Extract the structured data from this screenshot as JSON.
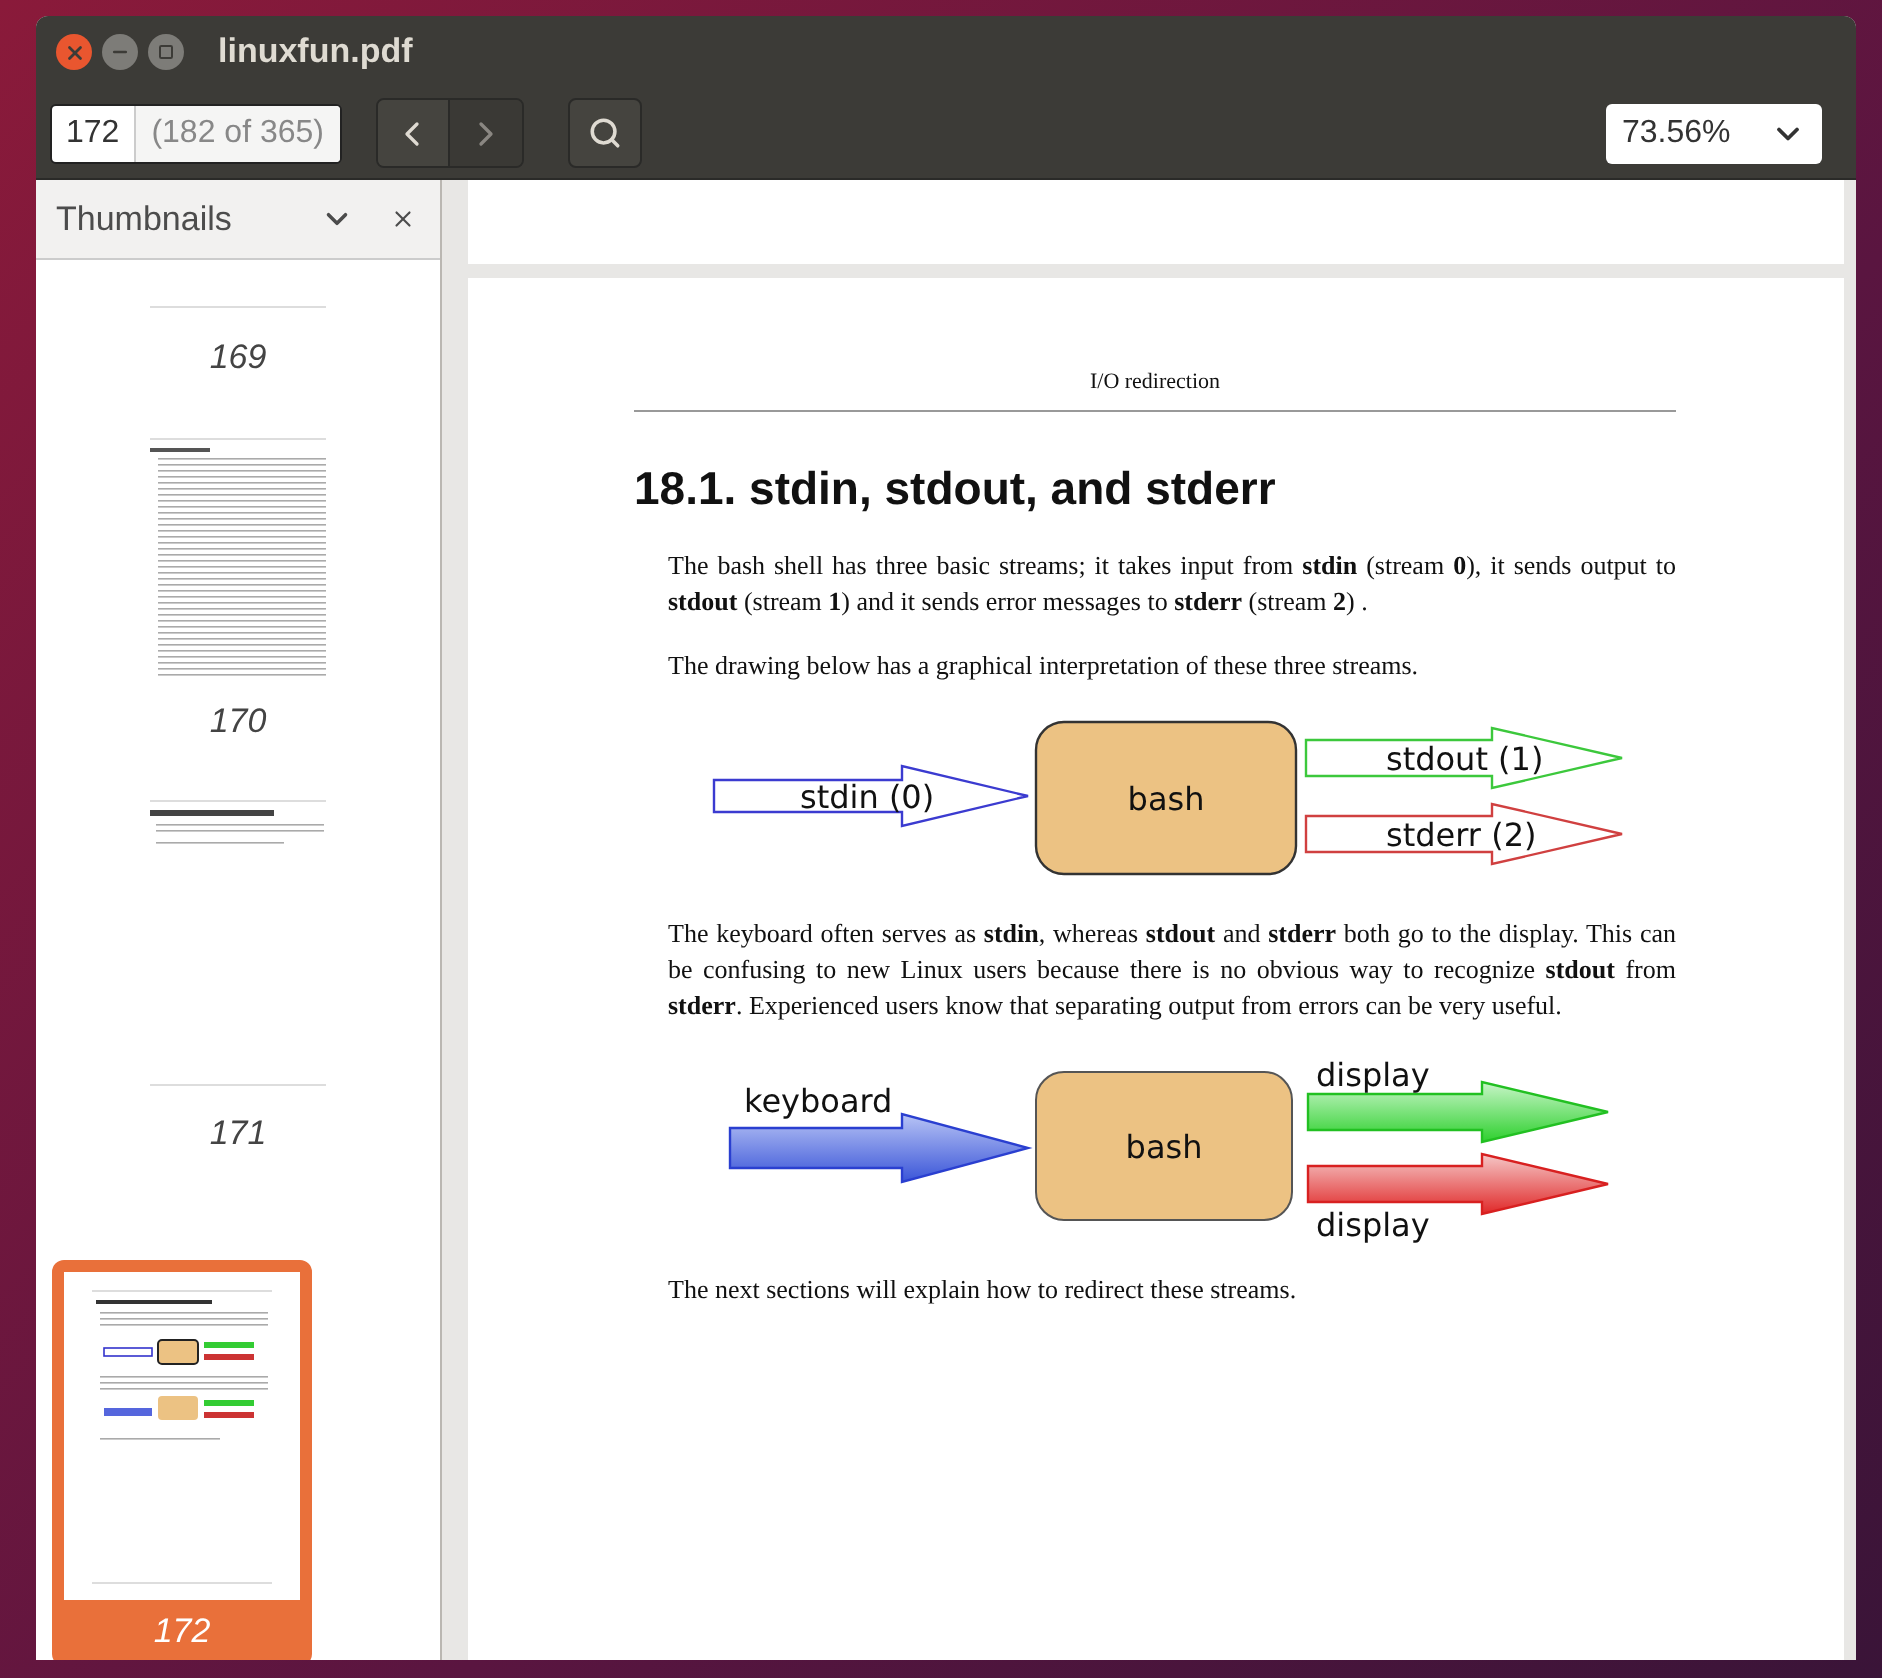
{
  "window": {
    "title": "linuxfun.pdf"
  },
  "toolbar": {
    "page_field": "172",
    "page_count": "(182 of 365)",
    "zoom": "73.56%"
  },
  "sidebar": {
    "title": "Thumbnails",
    "thumbnails": [
      {
        "page": "169",
        "kind": "tail",
        "selected": false
      },
      {
        "page": "170",
        "kind": "toc",
        "selected": false
      },
      {
        "page": "171",
        "kind": "chapter",
        "selected": false
      },
      {
        "page": "172",
        "kind": "current",
        "selected": true
      }
    ]
  },
  "document": {
    "running_header": "I/O redirection",
    "heading": "18.1. stdin, stdout, and stderr",
    "blocks": [
      {
        "kind": "paragraph",
        "text": "The bash shell has three basic streams; it takes input from **stdin** (stream **0**), it sends output to **stdout** (stream **1**)  and it sends error messages to **stderr** (stream **2**) ."
      },
      {
        "kind": "paragraph",
        "text": "The drawing below has a graphical interpretation of these three streams."
      },
      {
        "kind": "outline_diagram",
        "input": "stdin (0)",
        "center": "bash",
        "outputs": [
          "stdout (1)",
          "stderr (2)"
        ]
      },
      {
        "kind": "paragraph",
        "text": "The keyboard often serves as **stdin**, whereas **stdout** and **stderr** both go to the display. This can be confusing to new Linux users because there is no obvious way to recognize **stdout** from **stderr**. Experienced users know that separating output from errors can be very useful."
      },
      {
        "kind": "filled_diagram",
        "input": "keyboard",
        "center": "bash",
        "outputs": [
          "display",
          "display"
        ]
      },
      {
        "kind": "paragraph",
        "text": "The next sections will explain how to redirect these streams."
      }
    ]
  }
}
